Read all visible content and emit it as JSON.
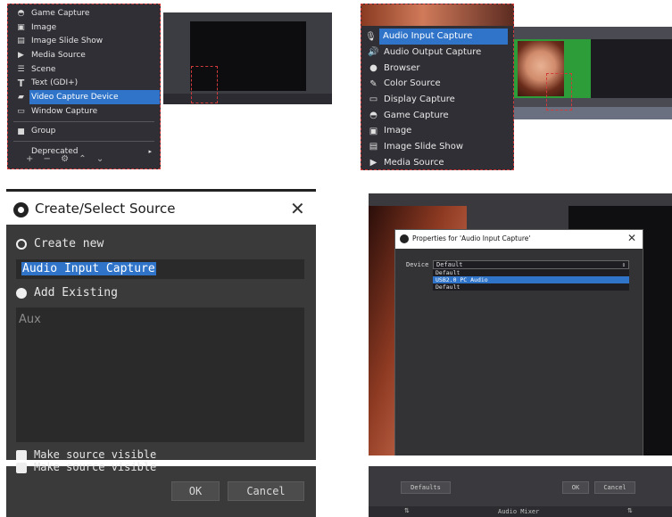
{
  "panel1": {
    "menu_items": [
      {
        "label": "Game Capture",
        "icon": "gamepad-icon"
      },
      {
        "label": "Image",
        "icon": "image-icon"
      },
      {
        "label": "Image Slide Show",
        "icon": "slideshow-icon"
      },
      {
        "label": "Media Source",
        "icon": "play-icon"
      },
      {
        "label": "Scene",
        "icon": "list-icon"
      },
      {
        "label": "Text (GDI+)",
        "icon": "text-icon"
      },
      {
        "label": "Video Capture Device",
        "icon": "camera-icon"
      },
      {
        "label": "Window Capture",
        "icon": "window-icon"
      },
      {
        "label": "Group",
        "icon": "folder-icon"
      },
      {
        "label": "Deprecated",
        "icon": "submenu-arrow-icon"
      }
    ],
    "selected_index": 6
  },
  "panel2": {
    "menu_items": [
      {
        "label": "Audio Input Capture",
        "icon": "microphone-icon"
      },
      {
        "label": "Audio Output Capture",
        "icon": "speaker-icon"
      },
      {
        "label": "Browser",
        "icon": "globe-icon"
      },
      {
        "label": "Color Source",
        "icon": "brush-icon"
      },
      {
        "label": "Display Capture",
        "icon": "monitor-icon"
      },
      {
        "label": "Game Capture",
        "icon": "gamepad-icon"
      },
      {
        "label": "Image",
        "icon": "image-icon"
      },
      {
        "label": "Image Slide Show",
        "icon": "slideshow-icon"
      },
      {
        "label": "Media Source",
        "icon": "play-icon"
      }
    ],
    "selected_index": 0
  },
  "panel3": {
    "title": "Create/Select Source",
    "close_glyph": "✕",
    "create_new_label": "Create new",
    "name_value": "Audio Input Capture",
    "add_existing_label": "Add Existing",
    "existing_items": [
      "Aux"
    ],
    "make_visible_label": "Make source visible",
    "ok_label": "OK",
    "cancel_label": "Cancel"
  },
  "panel4": {
    "dialog_title": "Properties for 'Audio Input Capture'",
    "close_glyph": "✕",
    "device_label": "Device",
    "device_value": "Default",
    "device_options": [
      "Default",
      "USB2.0 PC Audio",
      "Default"
    ],
    "highlighted_option_index": 1,
    "defaults_label": "Defaults",
    "ok_label": "OK",
    "cancel_label": "Cancel",
    "mixer_label": "Audio Mixer"
  },
  "colors": {
    "selection": "#2f74c9",
    "dark_bg": "#2f2f35",
    "dashed_border": "#d23b3b"
  }
}
